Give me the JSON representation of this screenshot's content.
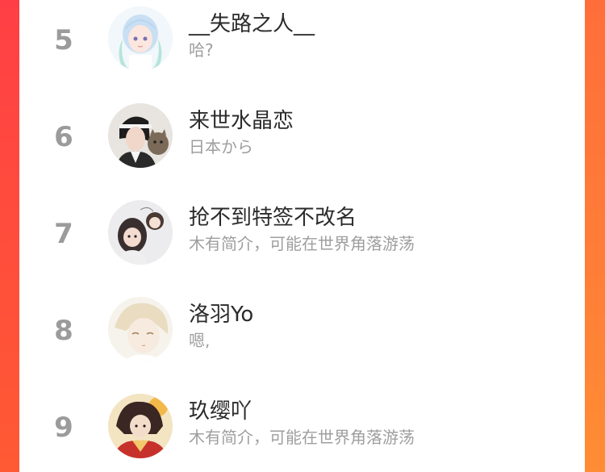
{
  "users": [
    {
      "rank": "5",
      "name": "__失路之人__",
      "bio": "哈?"
    },
    {
      "rank": "6",
      "name": "来世水晶恋",
      "bio": "日本から"
    },
    {
      "rank": "7",
      "name": "抢不到特签不改名",
      "bio": "木有简介，可能在世界角落游荡"
    },
    {
      "rank": "8",
      "name": "洛羽Yo",
      "bio": "嗯,"
    },
    {
      "rank": "9",
      "name": "玖缨吖",
      "bio": "木有简介，可能在世界角落游荡"
    }
  ],
  "colors": {
    "left_border": "#ff4a3e",
    "right_border": "#ff7f37",
    "rank_text": "#9b9b9b",
    "name_text": "#2b2b2b",
    "bio_text": "#9e9e9e"
  },
  "avatar_icons": [
    "anime-girl-avatar",
    "hanfu-man-cat-avatar",
    "chibi-pair-avatar",
    "blond-boy-avatar",
    "red-costume-girl-avatar"
  ]
}
